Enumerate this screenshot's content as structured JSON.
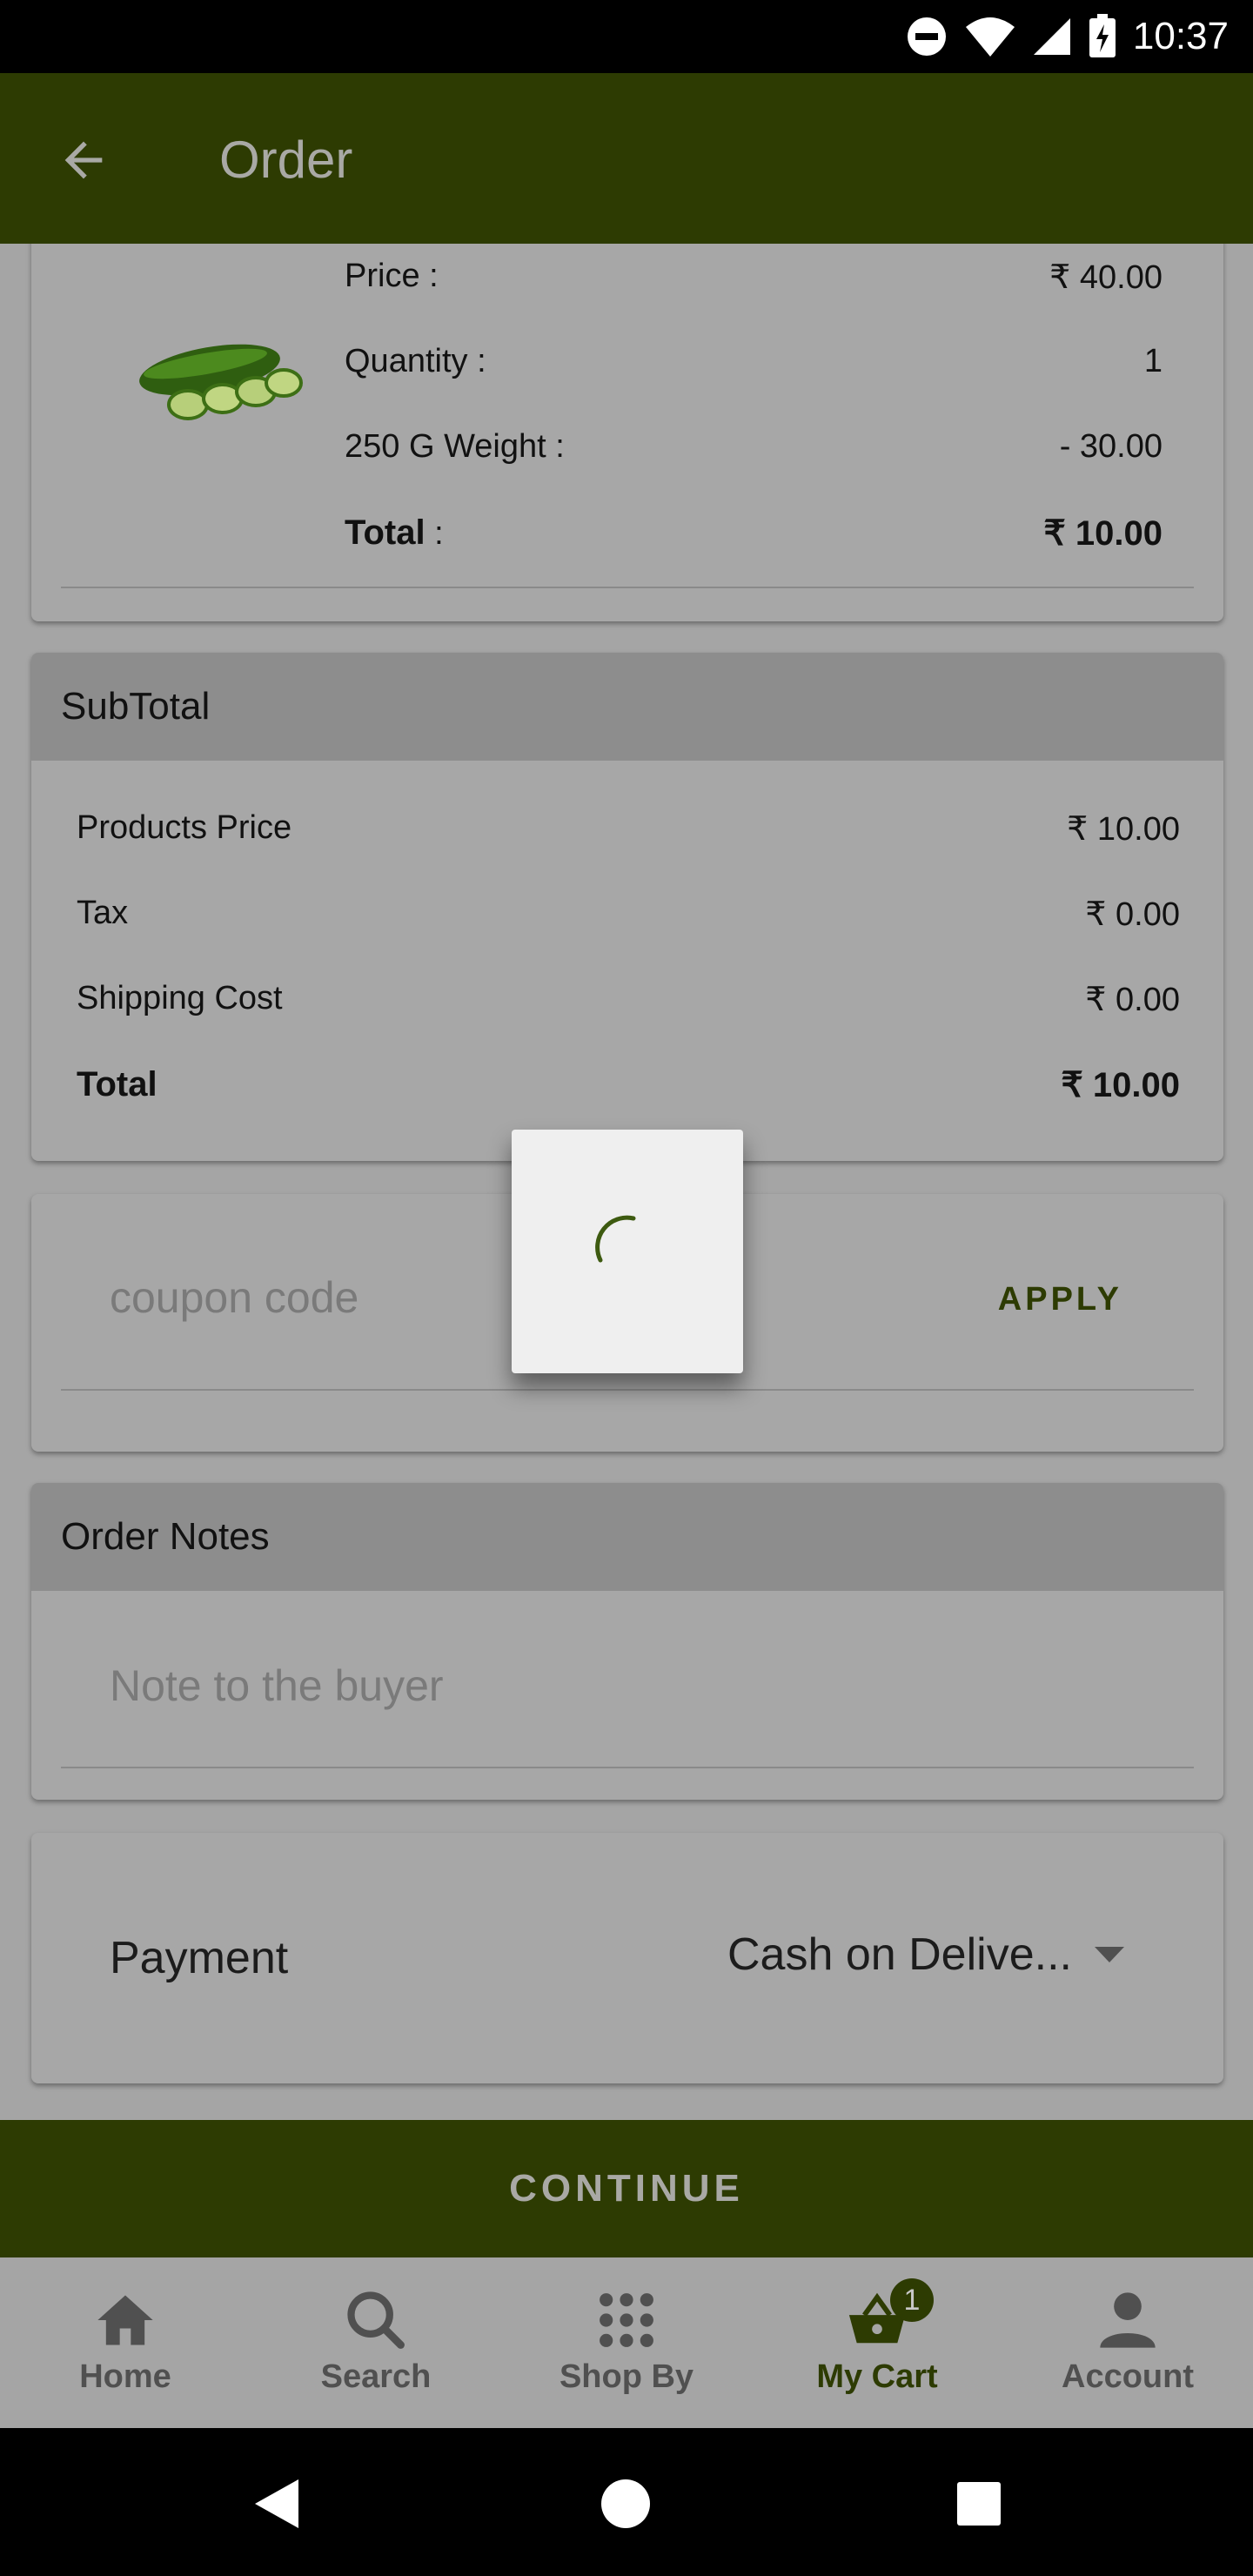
{
  "status_bar": {
    "time": "10:37"
  },
  "app_bar": {
    "title": "Order"
  },
  "product": {
    "price_label": "Price :",
    "price_value": "₹ 40.00",
    "quantity_label": "Quantity :",
    "quantity_value": "1",
    "weight_label": "250 G Weight :",
    "weight_value": "- 30.00",
    "total_label": "Total",
    "total_colon": " :",
    "total_value": "₹ 10.00"
  },
  "subtotal": {
    "header": "SubTotal",
    "rows": [
      {
        "label": "Products Price",
        "value": "₹ 10.00"
      },
      {
        "label": "Tax",
        "value": "₹ 0.00"
      },
      {
        "label": "Shipping Cost",
        "value": "₹ 0.00"
      }
    ],
    "total_label": "Total",
    "total_value": "₹ 10.00"
  },
  "coupon": {
    "placeholder": "coupon code",
    "apply_label": "APPLY"
  },
  "order_notes": {
    "header": "Order Notes",
    "placeholder": "Note to the buyer"
  },
  "payment": {
    "label": "Payment",
    "selected": "Cash on Delive..."
  },
  "continue_label": "CONTINUE",
  "bottom_nav": {
    "items": [
      {
        "label": "Home",
        "icon": "home-icon"
      },
      {
        "label": "Search",
        "icon": "search-icon"
      },
      {
        "label": "Shop By",
        "icon": "grid-icon"
      },
      {
        "label": "My Cart",
        "icon": "basket-icon",
        "badge": "1",
        "active": true
      },
      {
        "label": "Account",
        "icon": "person-icon"
      }
    ]
  },
  "colors": {
    "primary": "#2d3b02",
    "overlay_bg": "#a5a5a5"
  }
}
